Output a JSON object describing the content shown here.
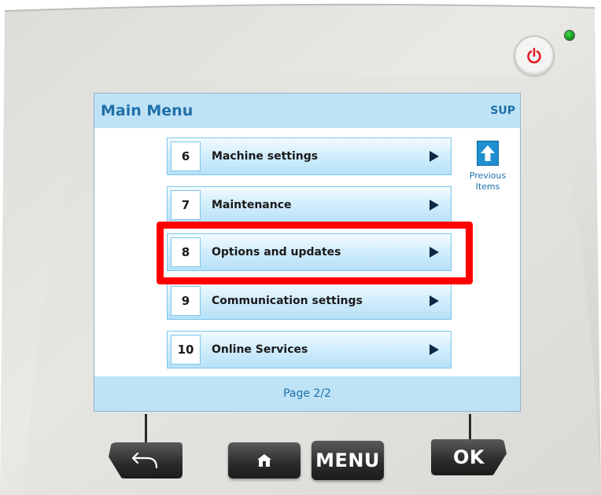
{
  "device": {
    "power_icon": "power-icon",
    "status_led_color": "#1fb82a"
  },
  "screen": {
    "title": "Main Menu",
    "user": "SUP",
    "accent_color": "#1f6fa8",
    "menu_items": [
      {
        "number": "6",
        "label": "Machine settings"
      },
      {
        "number": "7",
        "label": "Maintenance"
      },
      {
        "number": "8",
        "label": "Options and updates"
      },
      {
        "number": "9",
        "label": "Communication settings"
      },
      {
        "number": "10",
        "label": "Online Services"
      }
    ],
    "highlighted_item": "8",
    "highlight_color": "#ff0000",
    "previous_items": {
      "icon": "arrow-up-icon",
      "label_line1": "Previous",
      "label_line2": "Items"
    },
    "page_indicator": "Page 2/2"
  },
  "hardware_buttons": {
    "back_icon": "back-arrow-icon",
    "home_icon": "home-icon",
    "menu_label": "MENU",
    "ok_label": "OK"
  }
}
